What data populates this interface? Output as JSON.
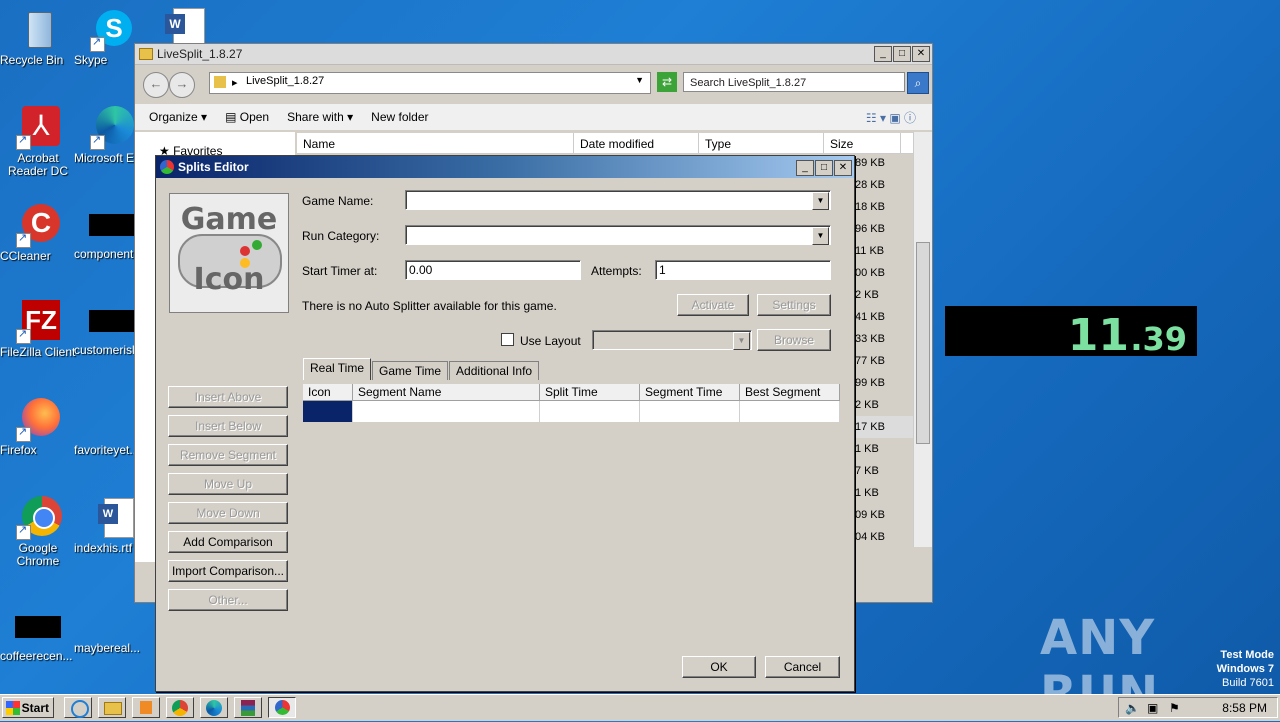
{
  "desktop": {
    "icons": [
      {
        "label": "Recycle Bin"
      },
      {
        "label": "Skype"
      },
      {
        "label": "Acrobat Reader DC"
      },
      {
        "label": "Microsoft Ed"
      },
      {
        "label": "CCleaner"
      },
      {
        "label": "component"
      },
      {
        "label": "FileZilla Client"
      },
      {
        "label": "customerisla"
      },
      {
        "label": "Firefox"
      },
      {
        "label": "favoriteyet..."
      },
      {
        "label": "Google Chrome"
      },
      {
        "label": "indexhis.rtf"
      },
      {
        "label": "coffeerecen..."
      },
      {
        "label": "maybereal..."
      }
    ]
  },
  "explorer": {
    "title": "LiveSplit_1.8.27",
    "address": "LiveSplit_1.8.27",
    "search_placeholder": "Search LiveSplit_1.8.27",
    "toolbar": {
      "organize": "Organize",
      "open": "Open",
      "share_with": "Share with",
      "new_folder": "New folder"
    },
    "columns": {
      "name": "Name",
      "date_modified": "Date modified",
      "type": "Type",
      "size": "Size"
    },
    "nav_favorites": "Favorites",
    "sizes": [
      "89 KB",
      "28 KB",
      "18 KB",
      "96 KB",
      "11 KB",
      "00 KB",
      "2 KB",
      "41 KB",
      "33 KB",
      "77 KB",
      "99 KB",
      "2 KB",
      "17 KB",
      "1 KB",
      "7 KB",
      "1 KB",
      "09 KB",
      "04 KB"
    ]
  },
  "splits_editor": {
    "title": "Splits Editor",
    "icon_text_top": "Game",
    "icon_text_bottom": "Icon",
    "game_name_label": "Game Name:",
    "game_name_value": "",
    "run_category_label": "Run Category:",
    "run_category_value": "",
    "start_timer_label": "Start Timer at:",
    "start_timer_value": "0.00",
    "attempts_label": "Attempts:",
    "attempts_value": "1",
    "auto_splitter_text": "There is no Auto Splitter available for this game.",
    "activate_label": "Activate",
    "settings_label": "Settings",
    "use_layout_label": "Use Layout",
    "browse_label": "Browse",
    "tabs": [
      {
        "label": "Real Time"
      },
      {
        "label": "Game Time"
      },
      {
        "label": "Additional Info"
      }
    ],
    "grid_headers": [
      "Icon",
      "Segment Name",
      "Split Time",
      "Segment Time",
      "Best Segment"
    ],
    "side_buttons": [
      "Insert Above",
      "Insert Below",
      "Remove Segment",
      "Move Up",
      "Move Down",
      "Add Comparison",
      "Import Comparison...",
      "Other..."
    ],
    "ok_label": "OK",
    "cancel_label": "Cancel"
  },
  "timer": {
    "main": "11",
    "fraction": ".39",
    "color": "#7be0a0"
  },
  "watermark": {
    "text": "ANY RUN",
    "test_mode": "Test Mode",
    "os": "Windows 7",
    "build": "Build 7601"
  },
  "taskbar": {
    "start_label": "Start",
    "clock": "8:58 PM"
  }
}
